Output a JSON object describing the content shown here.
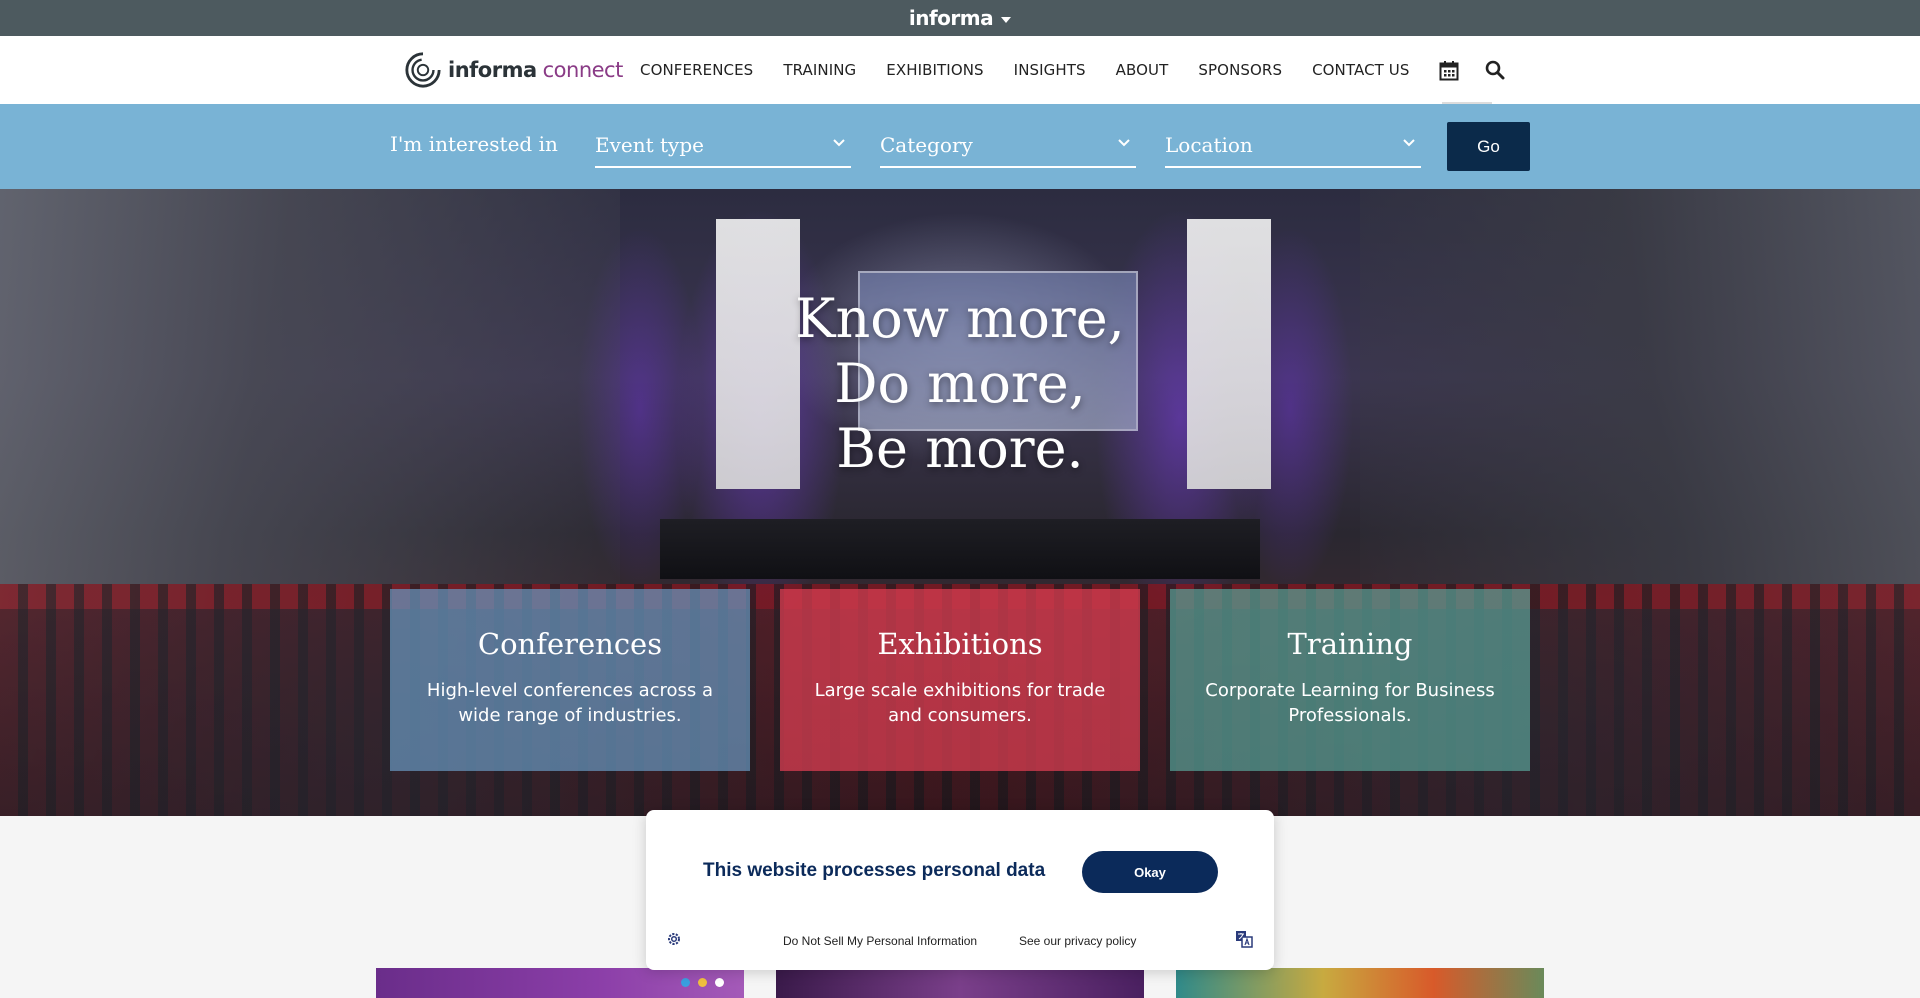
{
  "topbar": {
    "brand": "informa"
  },
  "nav": {
    "logo_word1": "informa",
    "logo_word2": "connect",
    "items": [
      "CONFERENCES",
      "TRAINING",
      "EXHIBITIONS",
      "INSIGHTS",
      "ABOUT",
      "SPONSORS",
      "CONTACT US"
    ],
    "icons": [
      "calendar-icon",
      "search-icon"
    ]
  },
  "filter": {
    "lead": "I'm interested in",
    "selects": [
      "Event type",
      "Category",
      "Location"
    ],
    "go_label": "Go"
  },
  "hero": {
    "headline": [
      "Know more,",
      "Do more,",
      "Be more."
    ],
    "cards": [
      {
        "title": "Conferences",
        "desc": "High-level conferences across a wide range of industries.",
        "color": "#6896be"
      },
      {
        "title": "Exhibitions",
        "desc": "Large scale exhibitions for trade and consumers.",
        "color": "#d23c50"
      },
      {
        "title": "Training",
        "desc": "Corporate Learning for Business Professionals.",
        "color": "#58a096"
      }
    ]
  },
  "consent": {
    "message": "This website processes personal data",
    "okay_label": "Okay",
    "do_not_sell": "Do Not Sell My Personal Information",
    "privacy": "See our privacy policy"
  },
  "colors": {
    "topbar": "#4d5a5f",
    "filter_bar": "#79b3d5",
    "go_button": "#0b2a4a",
    "consent_button": "#0b2a5a",
    "logo_accent": "#8a3b86"
  }
}
